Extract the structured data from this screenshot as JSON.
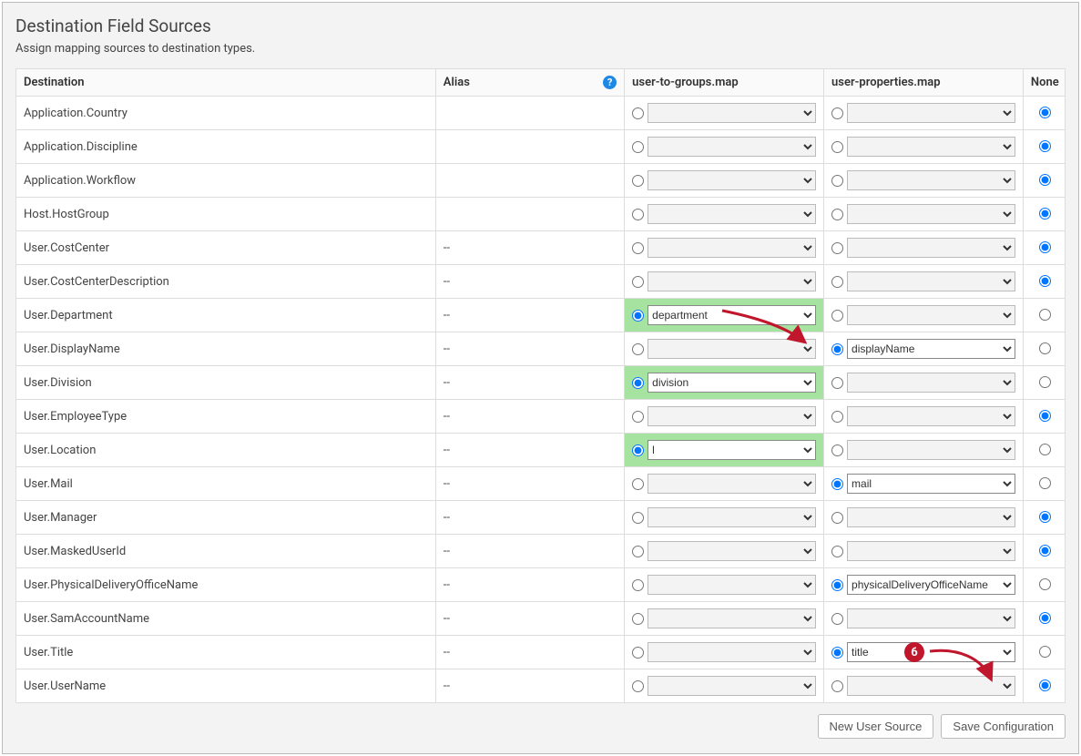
{
  "header": {
    "title": "Destination Field Sources",
    "subtitle": "Assign mapping sources to destination types."
  },
  "columns": {
    "dest": "Destination",
    "alias": "Alias",
    "src1": "user-to-groups.map",
    "src2": "user-properties.map",
    "none": "None"
  },
  "rows": [
    {
      "dest": "Application.Country",
      "alias": "",
      "src1_sel": "",
      "src2_sel": "",
      "active": "none",
      "hl1": false
    },
    {
      "dest": "Application.Discipline",
      "alias": "",
      "src1_sel": "",
      "src2_sel": "",
      "active": "none",
      "hl1": false
    },
    {
      "dest": "Application.Workflow",
      "alias": "",
      "src1_sel": "",
      "src2_sel": "",
      "active": "none",
      "hl1": false
    },
    {
      "dest": "Host.HostGroup",
      "alias": "",
      "src1_sel": "",
      "src2_sel": "",
      "active": "none",
      "hl1": false
    },
    {
      "dest": "User.CostCenter",
      "alias": "--",
      "src1_sel": "",
      "src2_sel": "",
      "active": "none",
      "hl1": false
    },
    {
      "dest": "User.CostCenterDescription",
      "alias": "--",
      "src1_sel": "",
      "src2_sel": "",
      "active": "none",
      "hl1": false
    },
    {
      "dest": "User.Department",
      "alias": "--",
      "src1_sel": "department",
      "src2_sel": "",
      "active": "src1",
      "hl1": true
    },
    {
      "dest": "User.DisplayName",
      "alias": "--",
      "src1_sel": "",
      "src2_sel": "displayName",
      "active": "src2",
      "hl1": false
    },
    {
      "dest": "User.Division",
      "alias": "--",
      "src1_sel": "division",
      "src2_sel": "",
      "active": "src1",
      "hl1": true
    },
    {
      "dest": "User.EmployeeType",
      "alias": "--",
      "src1_sel": "",
      "src2_sel": "",
      "active": "none",
      "hl1": false
    },
    {
      "dest": "User.Location",
      "alias": "--",
      "src1_sel": "l",
      "src2_sel": "",
      "active": "src1",
      "hl1": true
    },
    {
      "dest": "User.Mail",
      "alias": "--",
      "src1_sel": "",
      "src2_sel": "mail",
      "active": "src2",
      "hl1": false
    },
    {
      "dest": "User.Manager",
      "alias": "--",
      "src1_sel": "",
      "src2_sel": "",
      "active": "none",
      "hl1": false
    },
    {
      "dest": "User.MaskedUserId",
      "alias": "--",
      "src1_sel": "",
      "src2_sel": "",
      "active": "none",
      "hl1": false
    },
    {
      "dest": "User.PhysicalDeliveryOfficeName",
      "alias": "--",
      "src1_sel": "",
      "src2_sel": "physicalDeliveryOfficeName",
      "active": "src2",
      "hl1": false
    },
    {
      "dest": "User.SamAccountName",
      "alias": "--",
      "src1_sel": "",
      "src2_sel": "",
      "active": "none",
      "hl1": false
    },
    {
      "dest": "User.Title",
      "alias": "--",
      "src1_sel": "",
      "src2_sel": "title",
      "active": "src2",
      "hl1": false
    },
    {
      "dest": "User.UserName",
      "alias": "--",
      "src1_sel": "",
      "src2_sel": "",
      "active": "none",
      "hl1": false
    }
  ],
  "buttons": {
    "new_source": "New User Source",
    "save": "Save Configuration"
  },
  "annotations": {
    "callout_number": "6"
  }
}
